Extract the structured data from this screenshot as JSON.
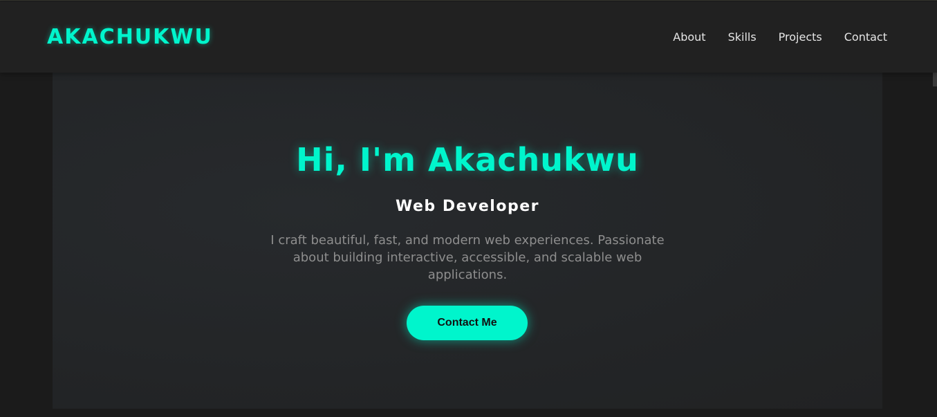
{
  "brand": {
    "logo": "AKACHUKWU"
  },
  "nav": {
    "items": [
      {
        "label": "About"
      },
      {
        "label": "Skills"
      },
      {
        "label": "Projects"
      },
      {
        "label": "Contact"
      }
    ]
  },
  "hero": {
    "title": "Hi, I'm Akachukwu",
    "subtitle": "Web Developer",
    "description": "I craft beautiful, fast, and modern web experiences. Passionate about building interactive, accessible, and scalable web applications.",
    "cta_label": "Contact Me"
  },
  "colors": {
    "accent": "#00f5cc",
    "background": "#1b1b1b",
    "navbar": "#212121",
    "hero_panel": "#232527",
    "muted_text": "#8e8e8e"
  }
}
